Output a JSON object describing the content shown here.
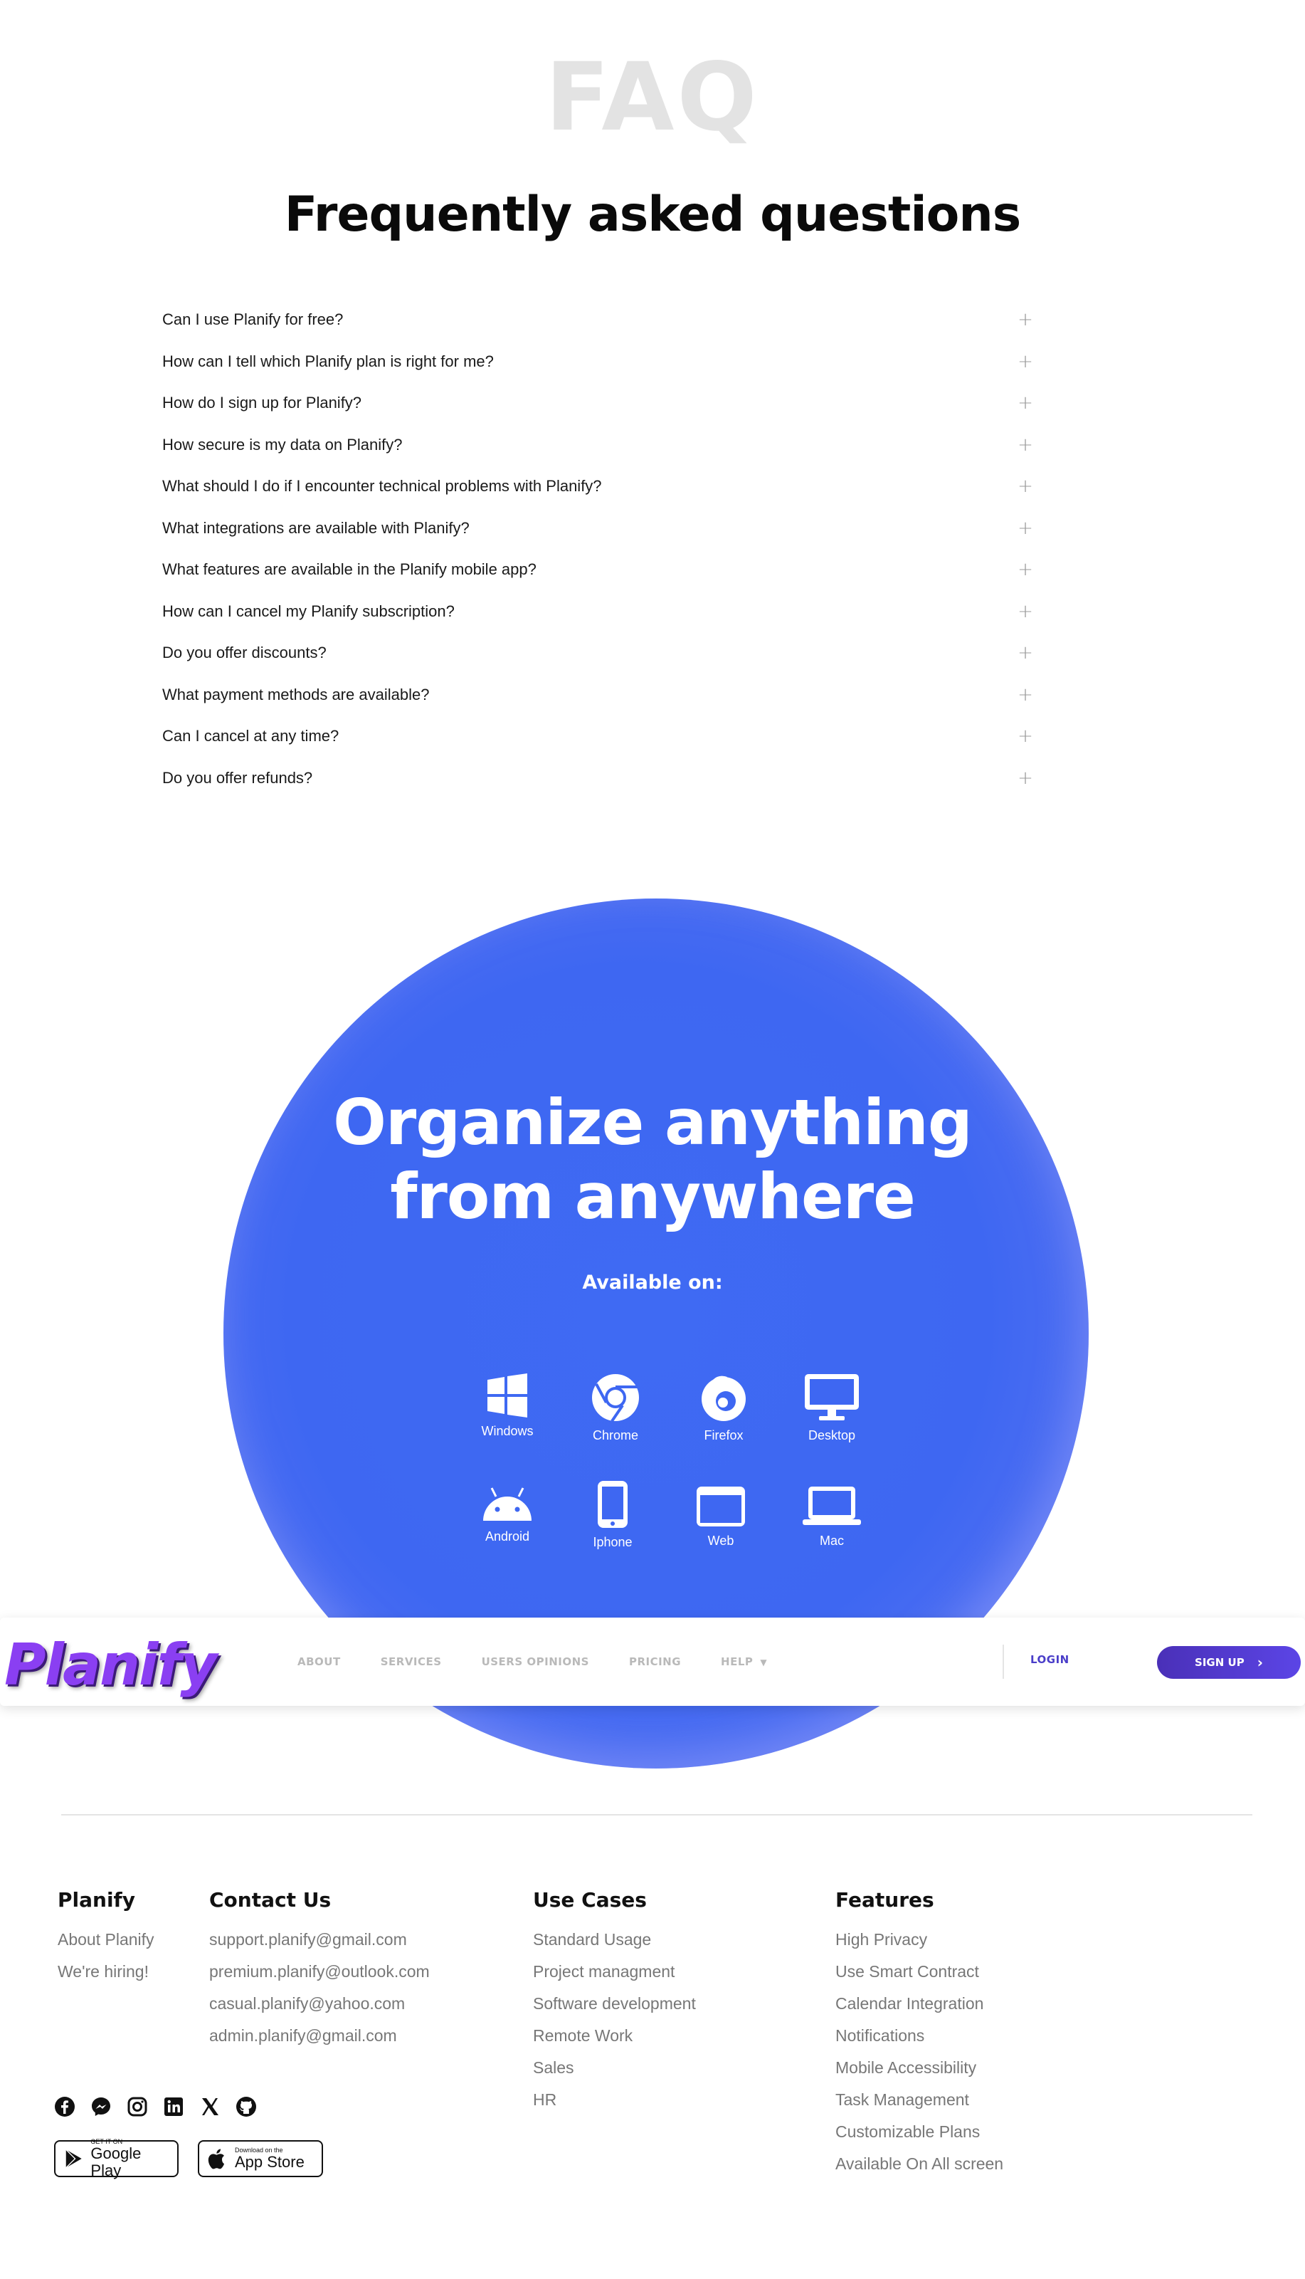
{
  "faq": {
    "watermark": "FAQ",
    "title": "Frequently asked questions",
    "items": [
      "Can I use Planify for free?",
      "How can I tell which Planify plan is right for me?",
      "How do I sign up for Planify?",
      "How secure is my data on Planify?",
      "What should I do if I encounter technical problems with Planify?",
      "What integrations are available with Planify?",
      "What features are available in the Planify mobile app?",
      "How can I cancel my Planify subscription?",
      "Do you offer discounts?",
      "What payment methods are available?",
      "Can I cancel at any time?",
      "Do you offer refunds?"
    ],
    "expand_symbol": "+"
  },
  "cta": {
    "title_line1": "Organize anything",
    "title_line2": "from anywhere",
    "available": "Available on:",
    "platforms": [
      {
        "label": "Windows",
        "icon": "windows-icon"
      },
      {
        "label": "Chrome",
        "icon": "chrome-icon"
      },
      {
        "label": "Firefox",
        "icon": "firefox-icon"
      },
      {
        "label": "Desktop",
        "icon": "desktop-icon"
      },
      {
        "label": "Android",
        "icon": "android-icon"
      },
      {
        "label": "Iphone",
        "icon": "iphone-icon"
      },
      {
        "label": "Web",
        "icon": "web-icon"
      },
      {
        "label": "Mac",
        "icon": "laptop-icon"
      }
    ],
    "circle_color": "#3e67f2"
  },
  "nav": {
    "logo": "Planify",
    "links": [
      "ABOUT",
      "SERVICES",
      "USERS OPINIONS",
      "PRICING",
      "HELP"
    ],
    "login": "LOGIN",
    "signup": "SIGN UP",
    "accent": "#4a3ec9"
  },
  "footer": {
    "planify": {
      "heading": "Planify",
      "links": [
        "About Planify",
        "We're hiring!"
      ]
    },
    "contact": {
      "heading": "Contact Us",
      "links": [
        "support.planify@gmail.com",
        "premium.planify@outlook.com",
        "casual.planify@yahoo.com",
        "admin.planify@gmail.com"
      ]
    },
    "use_cases": {
      "heading": "Use Cases",
      "links": [
        "Standard Usage",
        "Project managment",
        "Software development",
        "Remote Work",
        "Sales",
        "HR"
      ]
    },
    "features": {
      "heading": "Features",
      "links": [
        "High Privacy",
        "Use Smart Contract",
        "Calendar Integration",
        "Notifications",
        "Mobile Accessibility",
        "Task Management",
        "Customizable Plans",
        "Available On All screen"
      ]
    },
    "socials": [
      "facebook-icon",
      "messenger-icon",
      "instagram-icon",
      "linkedin-icon",
      "x-icon",
      "github-icon"
    ],
    "google_play": {
      "small": "GET IT ON",
      "big": "Google Play"
    },
    "app_store": {
      "small": "Download on the",
      "big": "App Store"
    }
  }
}
